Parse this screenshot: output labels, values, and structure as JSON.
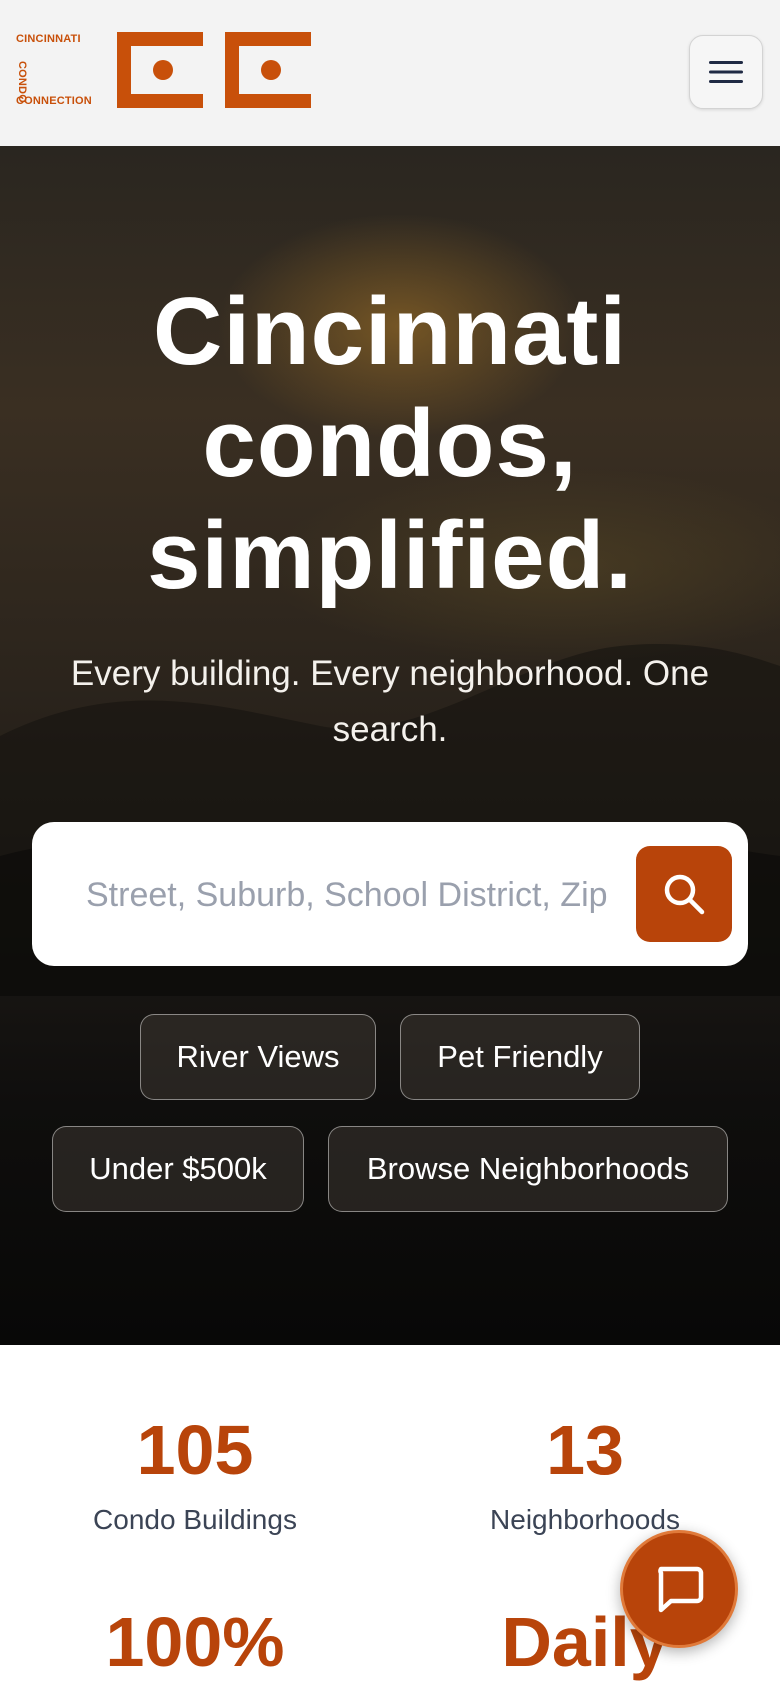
{
  "header": {
    "logo_line1": "CINCINNATI",
    "logo_line2": "CONDO",
    "logo_line3": "CONNECTION",
    "menu_icon": "hamburger-icon"
  },
  "hero": {
    "title_line1": "Cincinnati",
    "title_line2": "condos,",
    "title_line3": "simplified.",
    "subtitle": "Every building. Every neighborhood. One search.",
    "search_placeholder": "Street, Suburb, School District, Zip",
    "search_icon": "search-icon",
    "chips": [
      "River Views",
      "Pet Friendly",
      "Under $500k",
      "Browse Neighborhoods"
    ]
  },
  "stats": [
    {
      "value": "105",
      "label": "Condo Buildings"
    },
    {
      "value": "13",
      "label": "Neighborhoods"
    },
    {
      "value": "100%",
      "label": ""
    },
    {
      "value": "Daily",
      "label": ""
    }
  ],
  "chat": {
    "icon": "chat-bubble-icon"
  },
  "colors": {
    "accent": "#b8440a",
    "logo": "#c8500a",
    "header_bg": "#f3f3f3"
  }
}
